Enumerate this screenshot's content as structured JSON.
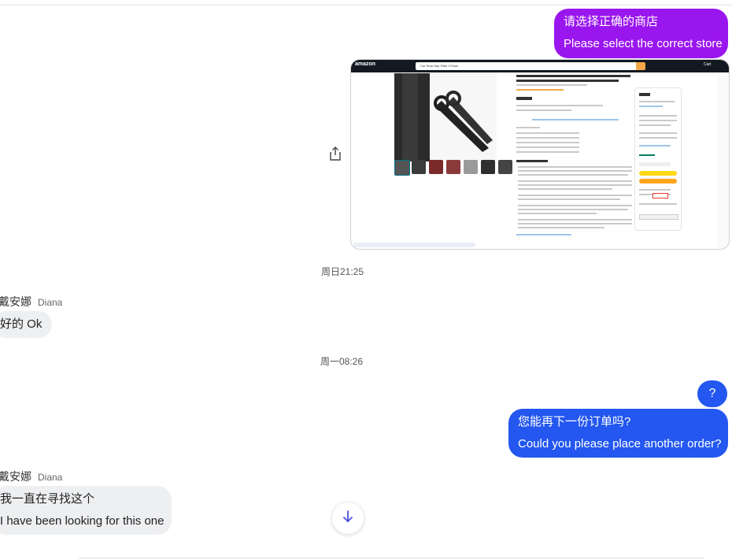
{
  "messages": {
    "store_zh": "请选择正确的商店",
    "store_en": "Please select the correct store",
    "ok_reply": "好的  Ok",
    "question_mark": "?",
    "order_zh": "您能再下一份订单吗?",
    "order_en": "Could you please place another order?",
    "looking_zh": "我一直在寻找这个",
    "looking_en": "I have been looking for this one"
  },
  "timestamps": {
    "first": "周日21:25",
    "second": "周一08:26"
  },
  "senders": {
    "name_zh": "戴安娜",
    "name_en": "Diana"
  },
  "attachment": {
    "logo": "amazon",
    "search_text": "Car Seat Gap Filler 2-Pack",
    "cart_label": "Cart"
  },
  "icons": {
    "share": "share-icon",
    "scroll_down": "arrow-down-icon"
  },
  "colors": {
    "outgoing_purple": "#9a16ee",
    "outgoing_blue": "#2357ef",
    "incoming_grey": "#eeeff1"
  }
}
